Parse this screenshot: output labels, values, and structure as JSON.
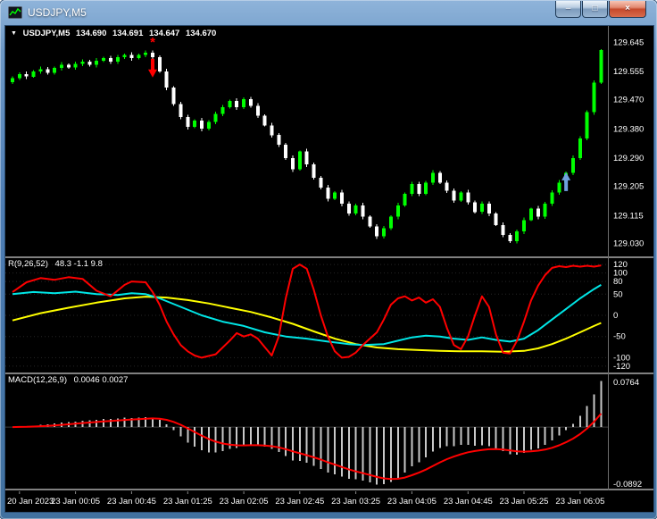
{
  "header": {
    "title": "USDJPY,M5"
  },
  "window_controls": {
    "minimize_glyph": "–",
    "maximize_glyph": "□",
    "close_glyph": "×"
  },
  "theme": {
    "background": "#000000",
    "text": "#ffffff",
    "divider": "#808080",
    "axis_line": "#6e6e6e",
    "chrome": "#4a7ab5"
  },
  "main_chart": {
    "ohlc": {
      "marker": "▼",
      "symbol": "USDJPY,M5",
      "open": "134.690",
      "high": "134.691",
      "low": "134.647",
      "close": "134.670"
    },
    "price_axis": [
      129.645,
      129.555,
      129.47,
      129.38,
      129.29,
      129.205,
      129.115,
      129.03
    ]
  },
  "indicator1": {
    "label": "R(9,26,52)",
    "values": "48.3 -1.1 9.8",
    "axis": [
      120,
      100,
      80,
      50,
      0,
      -50,
      -100,
      -120
    ]
  },
  "indicator2": {
    "label": "MACD(12,26,9)",
    "values": "0.0046 0.0027",
    "axis_top": "0.0764",
    "axis_bottom": "-0.0892"
  },
  "time_axis": {
    "labels": [
      "20 Jan 2023",
      "23 Jan 00:05",
      "23 Jan 00:45",
      "23 Jan 01:25",
      "23 Jan 02:05",
      "23 Jan 02:45",
      "23 Jan 03:25",
      "23 Jan 04:05",
      "23 Jan 04:45",
      "23 Jan 05:25",
      "23 Jan 06:05"
    ],
    "indices": [
      1,
      9,
      17,
      25,
      33,
      41,
      49,
      57,
      65,
      73,
      81
    ]
  },
  "chart_data": {
    "type": "candlestick",
    "symbol": "USDJPY",
    "timeframe": "M5",
    "price_range": [
      129.03,
      129.645
    ],
    "closes": [
      129.535,
      129.548,
      129.54,
      129.556,
      129.563,
      129.552,
      129.566,
      129.576,
      129.568,
      129.579,
      129.586,
      129.576,
      129.589,
      129.596,
      129.586,
      129.599,
      129.606,
      129.597,
      129.606,
      129.613,
      129.6,
      129.556,
      129.506,
      129.456,
      129.416,
      129.386,
      129.406,
      129.381,
      129.401,
      129.426,
      129.446,
      129.466,
      129.446,
      129.471,
      129.451,
      129.421,
      129.391,
      129.361,
      129.331,
      129.291,
      129.256,
      129.311,
      129.271,
      129.231,
      129.201,
      129.166,
      129.186,
      129.151,
      129.121,
      129.146,
      129.111,
      129.081,
      129.051,
      129.076,
      129.111,
      129.146,
      129.181,
      129.211,
      129.181,
      129.216,
      129.246,
      129.216,
      129.191,
      129.161,
      129.186,
      129.156,
      129.126,
      129.151,
      129.121,
      129.086,
      129.056,
      129.036,
      129.066,
      129.101,
      129.136,
      129.111,
      129.151,
      129.186,
      129.216,
      129.246,
      129.291,
      129.351,
      129.431,
      129.521,
      129.621
    ],
    "signals": [
      {
        "type": "sell",
        "index": 20,
        "price": 129.537,
        "glyph": "*",
        "glyph_price": 129.648
      },
      {
        "type": "buy",
        "index": 79,
        "price": 129.247
      }
    ],
    "oscillator": {
      "range": [
        -135,
        135
      ],
      "red": [
        [
          0,
          55
        ],
        [
          2,
          78
        ],
        [
          4,
          88
        ],
        [
          6,
          84
        ],
        [
          8,
          90
        ],
        [
          10,
          86
        ],
        [
          12,
          58
        ],
        [
          14,
          45
        ],
        [
          16,
          72
        ],
        [
          17,
          80
        ],
        [
          19,
          78
        ],
        [
          20,
          55
        ],
        [
          21,
          25
        ],
        [
          22,
          -15
        ],
        [
          23,
          -45
        ],
        [
          24,
          -70
        ],
        [
          25,
          -85
        ],
        [
          26,
          -95
        ],
        [
          27,
          -100
        ],
        [
          29,
          -92
        ],
        [
          31,
          -60
        ],
        [
          32,
          -42
        ],
        [
          33,
          -50
        ],
        [
          34,
          -45
        ],
        [
          35,
          -55
        ],
        [
          36,
          -75
        ],
        [
          37,
          -95
        ],
        [
          38,
          -50
        ],
        [
          39,
          40
        ],
        [
          40,
          110
        ],
        [
          41,
          120
        ],
        [
          42,
          110
        ],
        [
          43,
          60
        ],
        [
          44,
          0
        ],
        [
          45,
          -50
        ],
        [
          46,
          -85
        ],
        [
          47,
          -100
        ],
        [
          48,
          -98
        ],
        [
          49,
          -88
        ],
        [
          50,
          -70
        ],
        [
          52,
          -40
        ],
        [
          53,
          -10
        ],
        [
          54,
          25
        ],
        [
          55,
          40
        ],
        [
          56,
          45
        ],
        [
          57,
          35
        ],
        [
          58,
          42
        ],
        [
          59,
          30
        ],
        [
          60,
          38
        ],
        [
          61,
          20
        ],
        [
          62,
          -30
        ],
        [
          63,
          -70
        ],
        [
          64,
          -80
        ],
        [
          65,
          -50
        ],
        [
          66,
          0
        ],
        [
          67,
          45
        ],
        [
          68,
          20
        ],
        [
          69,
          -45
        ],
        [
          70,
          -88
        ],
        [
          71,
          -90
        ],
        [
          72,
          -60
        ],
        [
          73,
          -15
        ],
        [
          74,
          35
        ],
        [
          75,
          70
        ],
        [
          76,
          95
        ],
        [
          77,
          112
        ],
        [
          78,
          116
        ],
        [
          79,
          114
        ],
        [
          80,
          117
        ],
        [
          81,
          115
        ],
        [
          82,
          117
        ],
        [
          83,
          115
        ],
        [
          84,
          118
        ]
      ],
      "cyan": [
        [
          0,
          50
        ],
        [
          3,
          55
        ],
        [
          6,
          52
        ],
        [
          9,
          56
        ],
        [
          12,
          50
        ],
        [
          15,
          48
        ],
        [
          17,
          52
        ],
        [
          19,
          50
        ],
        [
          21,
          40
        ],
        [
          24,
          20
        ],
        [
          27,
          0
        ],
        [
          30,
          -15
        ],
        [
          33,
          -25
        ],
        [
          36,
          -40
        ],
        [
          39,
          -50
        ],
        [
          42,
          -55
        ],
        [
          45,
          -62
        ],
        [
          48,
          -68
        ],
        [
          50,
          -70
        ],
        [
          53,
          -68
        ],
        [
          55,
          -60
        ],
        [
          57,
          -52
        ],
        [
          59,
          -48
        ],
        [
          61,
          -50
        ],
        [
          63,
          -55
        ],
        [
          65,
          -58
        ],
        [
          67,
          -52
        ],
        [
          69,
          -58
        ],
        [
          71,
          -62
        ],
        [
          73,
          -55
        ],
        [
          75,
          -35
        ],
        [
          77,
          -10
        ],
        [
          79,
          15
        ],
        [
          81,
          40
        ],
        [
          83,
          62
        ],
        [
          84,
          72
        ]
      ],
      "yellow": [
        [
          0,
          -12
        ],
        [
          4,
          5
        ],
        [
          8,
          18
        ],
        [
          12,
          30
        ],
        [
          16,
          40
        ],
        [
          19,
          44
        ],
        [
          22,
          42
        ],
        [
          25,
          36
        ],
        [
          28,
          28
        ],
        [
          31,
          18
        ],
        [
          34,
          8
        ],
        [
          37,
          -5
        ],
        [
          40,
          -20
        ],
        [
          43,
          -38
        ],
        [
          46,
          -55
        ],
        [
          49,
          -68
        ],
        [
          52,
          -76
        ],
        [
          55,
          -80
        ],
        [
          58,
          -82
        ],
        [
          61,
          -84
        ],
        [
          64,
          -85
        ],
        [
          67,
          -85
        ],
        [
          70,
          -86
        ],
        [
          73,
          -84
        ],
        [
          75,
          -78
        ],
        [
          77,
          -68
        ],
        [
          79,
          -55
        ],
        [
          81,
          -40
        ],
        [
          83,
          -25
        ],
        [
          84,
          -18
        ]
      ]
    },
    "macd": {
      "fast": 12,
      "slow": 26,
      "signal": 9
    },
    "colors": {
      "bull": "#00ff00",
      "bear": "#ffffff",
      "osc_red": "#ff0000",
      "osc_cyan": "#00e6e6",
      "osc_yellow": "#ffff00",
      "macd_hist": "#c8c8c8",
      "macd_signal": "#ff0000",
      "sell": "#ff0000",
      "buy": "#6f9fdf"
    }
  }
}
